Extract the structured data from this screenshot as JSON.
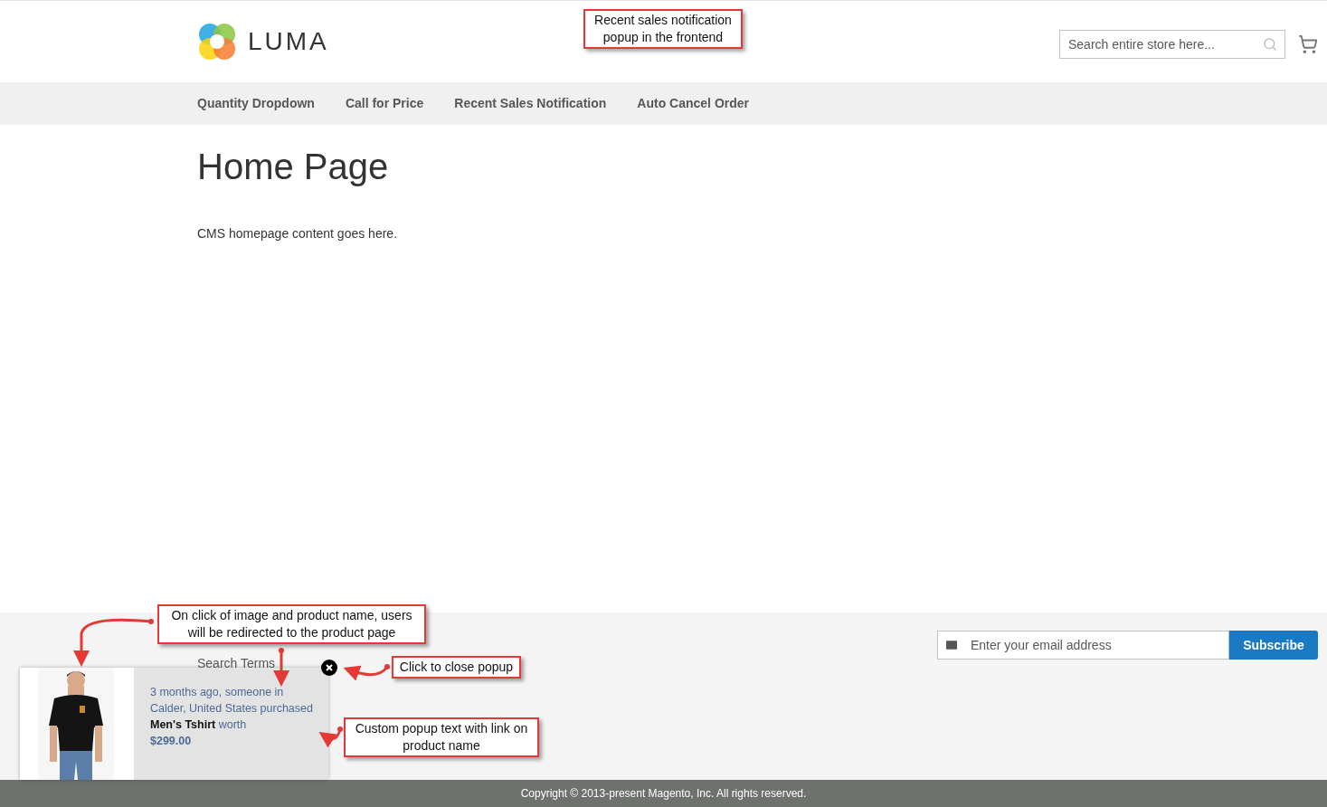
{
  "header": {
    "logo_text": "LUMA",
    "search": {
      "placeholder": "Search entire store here..."
    }
  },
  "nav": {
    "items": [
      "Quantity Dropdown",
      "Call for Price",
      "Recent Sales Notification",
      "Auto Cancel Order"
    ]
  },
  "page": {
    "title": "Home Page",
    "body": "CMS homepage content goes here."
  },
  "footer": {
    "links": [
      "Search Terms"
    ],
    "newsletter": {
      "placeholder": "Enter your email address",
      "button": "Subscribe"
    },
    "copyright": "Copyright © 2013-present Magento, Inc. All rights reserved."
  },
  "popup": {
    "before": "3 months ago, someone in Calder, United States purchased",
    "product_name": "Men's Tshirt",
    "after": "worth",
    "price": "$299.00"
  },
  "annotations": [
    {
      "text": "Recent sales notification popup in the frontend"
    },
    {
      "text": "On click of image and product name, users will be redirected to the product page"
    },
    {
      "text": "Click to close popup"
    },
    {
      "text": "Custom popup text with link on product name"
    }
  ]
}
